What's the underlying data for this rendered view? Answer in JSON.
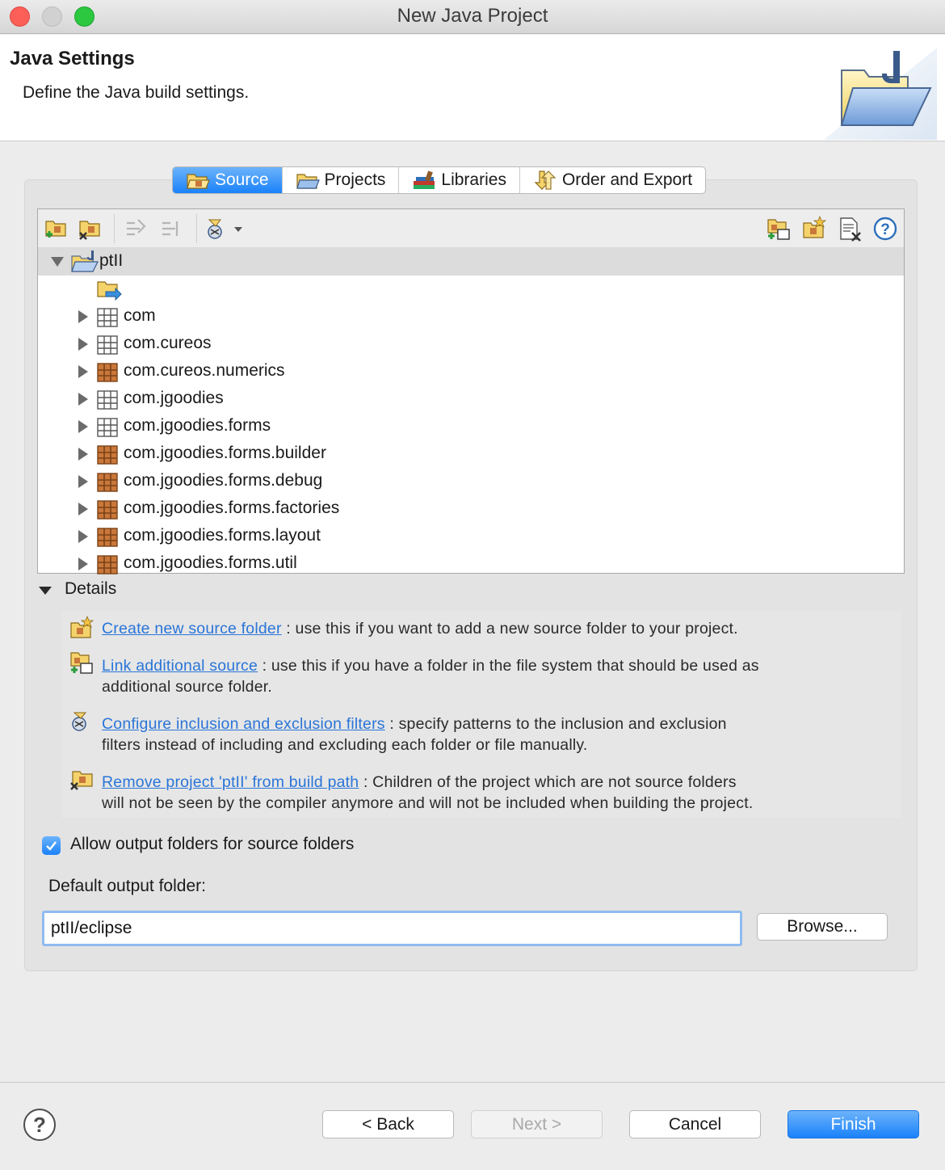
{
  "window": {
    "title": "New Java Project"
  },
  "header": {
    "title": "Java Settings",
    "description": "Define the Java build settings."
  },
  "tabs": [
    {
      "label": "Source",
      "icon": "source-folder-icon",
      "active": true
    },
    {
      "label": "Projects",
      "icon": "projects-icon",
      "active": false
    },
    {
      "label": "Libraries",
      "icon": "libraries-icon",
      "active": false
    },
    {
      "label": "Order and Export",
      "icon": "order-export-icon",
      "active": false
    }
  ],
  "toolbar": {
    "left_icons": [
      "add-source-folder-icon",
      "remove-source-folder-icon",
      "link-in-icon",
      "link-out-icon",
      "filter-config-icon"
    ],
    "right_icons": [
      "link-source-icon",
      "new-source-folder-icon",
      "remove-icon",
      "help-icon"
    ]
  },
  "tree": {
    "root": "ptII",
    "children": [
      {
        "label": "com",
        "icon": "package-empty-icon"
      },
      {
        "label": "com.cureos",
        "icon": "package-empty-icon"
      },
      {
        "label": "com.cureos.numerics",
        "icon": "package-icon"
      },
      {
        "label": "com.jgoodies",
        "icon": "package-empty-icon"
      },
      {
        "label": "com.jgoodies.forms",
        "icon": "package-empty-icon"
      },
      {
        "label": "com.jgoodies.forms.builder",
        "icon": "package-icon"
      },
      {
        "label": "com.jgoodies.forms.debug",
        "icon": "package-icon"
      },
      {
        "label": "com.jgoodies.forms.factories",
        "icon": "package-icon"
      },
      {
        "label": "com.jgoodies.forms.layout",
        "icon": "package-icon"
      },
      {
        "label": "com.jgoodies.forms.util",
        "icon": "package-icon"
      }
    ]
  },
  "details": {
    "label": "Details",
    "items": [
      {
        "link": "Create new source folder",
        "line1": " : use this if you want to add a new source folder to your project.",
        "line2": ""
      },
      {
        "link": "Link additional source",
        "line1": " : use this if you have a folder in the file system that should be used as",
        "line2": "additional source folder."
      },
      {
        "link": "Configure inclusion and exclusion filters",
        "line1": " : specify patterns to the inclusion and exclusion",
        "line2": "filters instead of including and excluding each folder or file manually."
      },
      {
        "link": "Remove project 'ptII' from build path",
        "line1": " : Children of the project which are not source folders",
        "line2": "will not be seen by the compiler anymore and will not be included when building the project."
      }
    ]
  },
  "options": {
    "allow_output_label": "Allow output folders for source folders",
    "allow_output_checked": true,
    "default_output_label": "Default output folder:",
    "default_output_value": "ptII/eclipse",
    "browse_label": "Browse..."
  },
  "buttons": {
    "help": "?",
    "back": "< Back",
    "next": "Next >",
    "cancel": "Cancel",
    "finish": "Finish"
  },
  "colors": {
    "accent": "#1a82fb",
    "link": "#2a75d8"
  }
}
